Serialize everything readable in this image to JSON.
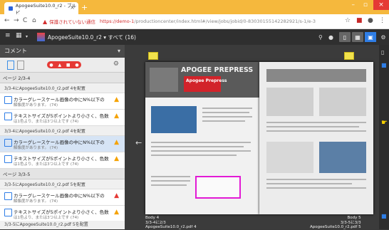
{
  "browser": {
    "tab_title": "ApogeeSuite10.0_r2 - ブルビ",
    "url_warning": "保護されていない通信",
    "url_host": "https://demo-1",
    "url_path": "/productioncenter/index.html#/view/jobs/jobid/0-83030155142282921/s-1/e-3",
    "nav_back": "←",
    "nav_forward": "→",
    "nav_reload": "C",
    "nav_home": "⌂",
    "star": "☆",
    "menu": "⋮"
  },
  "toolbar": {
    "menu_icon": "≡",
    "grid_icon": "▦",
    "publication_title": "ApogeeSuite10.0_r2 ▾ すべて (16)",
    "search_icon": "⚲",
    "info_icon": "●",
    "view_single": "▯",
    "view_grid": "▦",
    "view_spread": "▣",
    "settings_icon": "⚙"
  },
  "sidebar": {
    "title": "コメント",
    "collapse": "▾",
    "groups": [
      {
        "header": "ページ 2/3-4",
        "file": "3/3-4にApogeeSuite10.0_r2.pdf 4を配置",
        "items": [
          {
            "line1": "カラーグレースケール画像の中にN%以下の",
            "line2": "解像度があります。 (74)",
            "selected": false
          },
          {
            "line1": "テキストサイズが5ポイントより小さく、色数",
            "line2": "は1色より、または3つ以上です (74)",
            "selected": false
          }
        ]
      },
      {
        "header": "",
        "file": "3/3-4にApogeeSuite10.0_r2.pdf 4を配置",
        "items": [
          {
            "line1": "カラーグレースケール画像の中にN%以下の",
            "line2": "解像度があります。 (74)",
            "selected": true
          },
          {
            "line1": "テキストサイズが5ポイントより小さく、色数",
            "line2": "は1色より、または3つ以上です (74)",
            "selected": false
          }
        ]
      },
      {
        "header": "ページ 3/3-5",
        "file": "3/3-5にApogeeSuite10.0_r2.pdf 5を配置",
        "items": [
          {
            "line1": "カラーグレースケール画像の中にN%以下の",
            "line2": "解像度があります。 (74)",
            "selected": false
          },
          {
            "line1": "テキストサイズが5ポイントより小さく、色数",
            "line2": "は1色より、または3つ以上です (74)",
            "selected": false
          }
        ]
      }
    ],
    "footer": "3/3-5にApogeeSuite10.0_r2.pdf 5を配置"
  },
  "viewer": {
    "brand": "APOGEE PREPRESS",
    "brand_sub1": "Apogee Prepress",
    "brand_sub2": "",
    "left_info": [
      "Body 4",
      "3/3-4に2/3",
      "ApogeeSuite10.0_r2.pdf 4"
    ],
    "right_info": [
      "Body 5",
      "3/3-5に3/3",
      "ApogeeSuite10.0_r2.pdf 5"
    ]
  },
  "colors": {
    "titlebar": "#f5b83d",
    "accent": "#2f7ee6",
    "highlight": "#e21ad5",
    "warning": "#f5a200"
  }
}
